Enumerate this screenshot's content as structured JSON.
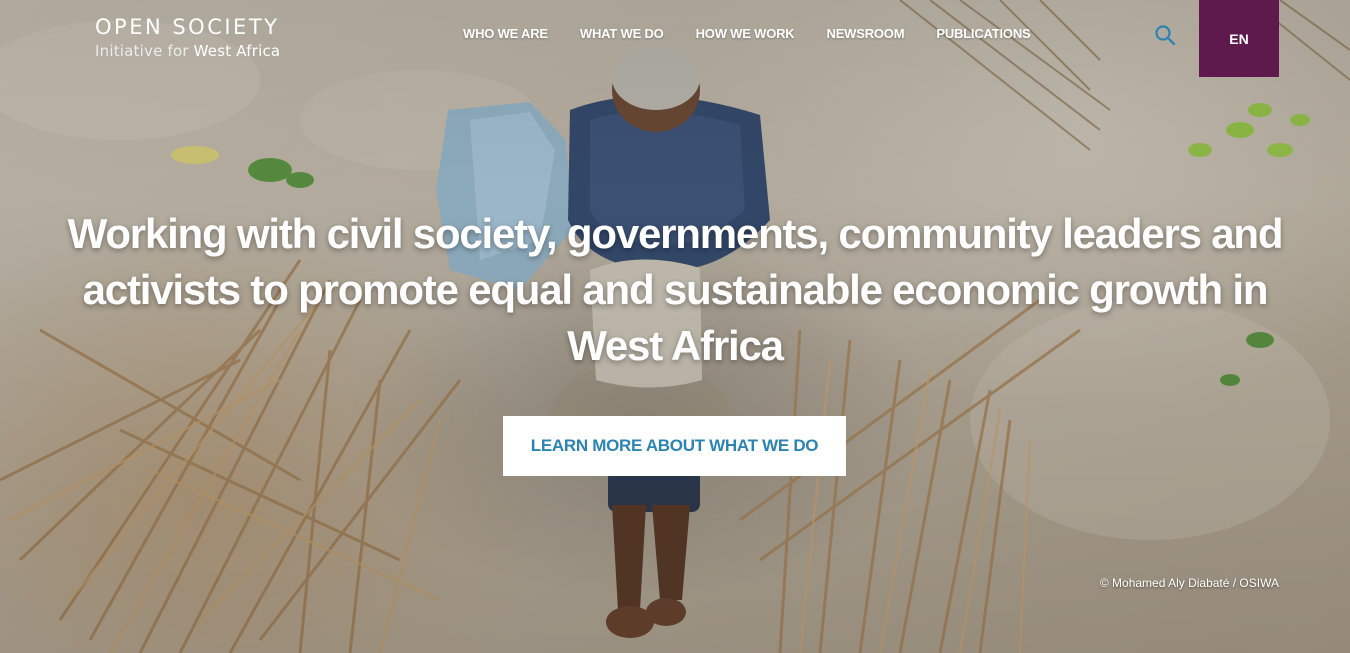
{
  "logo": {
    "line1": "OPEN SOCIETY",
    "line2_light": "Initiative for ",
    "line2_bold": "West Africa"
  },
  "nav": {
    "items": [
      "WHO WE ARE",
      "WHAT WE DO",
      "HOW WE WORK",
      "NEWSROOM",
      "PUBLICATIONS"
    ]
  },
  "header": {
    "search_icon": "search-icon",
    "language": "EN",
    "accent_color": "#5e1a4d",
    "icon_color": "#2b84b4"
  },
  "hero": {
    "headline": "Working with civil society, governments, community leaders and activists to promote equal and sustainable economic growth in West Africa",
    "cta_label": "LEARN MORE ABOUT WHAT WE DO",
    "cta_color": "#2b84b4",
    "photo_credit": "© Mohamed Aly Diabaté / OSIWA"
  }
}
